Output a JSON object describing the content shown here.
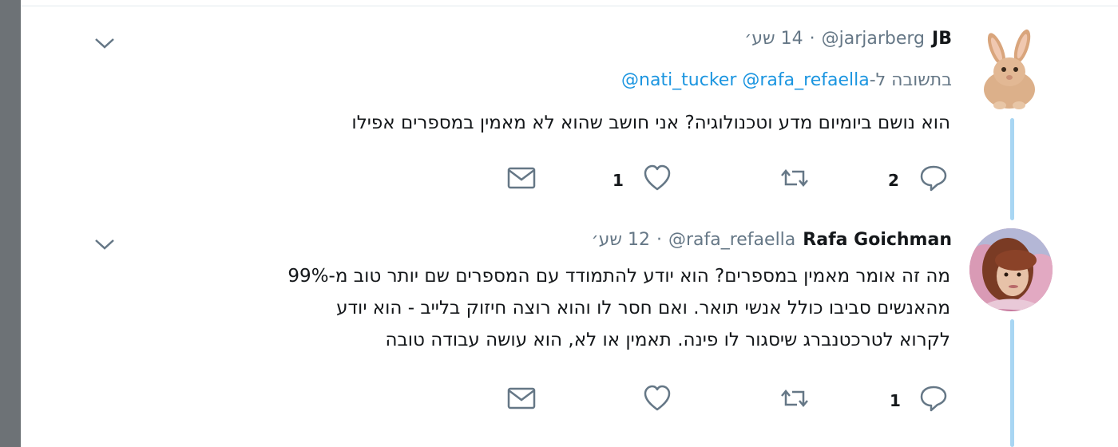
{
  "tweets": [
    {
      "name": "JB",
      "handle": "@jarjarberg",
      "separator": "·",
      "time": "14 שע׳",
      "reply_prefix": "בתשובה ל-",
      "reply_mentions": "@nati_tucker @rafa_refaella",
      "text_lines": [
        "הוא נושם ביומיום מדע וטכנולוגיה? אני חושב שהוא לא מאמין במספרים אפילו"
      ],
      "reply_count": "2",
      "like_count": "1",
      "avatar": "rabbit-avatar"
    },
    {
      "name": "Rafa Goichman",
      "handle": "@rafa_refaella",
      "separator": "·",
      "time": "12 שע׳",
      "text_lines": [
        "מה זה אומר מאמין במספרים? הוא יודע להתמודד עם המספרים שם יותר טוב מ-99%",
        "מהאנשים סביבו כולל אנשי תואר. ואם חסר לו והוא רוצה חיזוק בלייב - הוא יודע",
        "לקרוא לטרכטנברג שיסגור לו פינה. תאמין או לא, הוא עושה עבודה טובה"
      ],
      "reply_count": "1",
      "avatar": "person-avatar"
    }
  ],
  "icons": [
    "chevron-down-icon",
    "reply-icon",
    "retweet-icon",
    "like-icon",
    "direct-message-icon"
  ],
  "colors": {
    "link": "#1b95e0",
    "muted": "#657786",
    "thread_line": "#a8d6f3",
    "icon": "#657786",
    "left_bar": "#6d7276"
  }
}
